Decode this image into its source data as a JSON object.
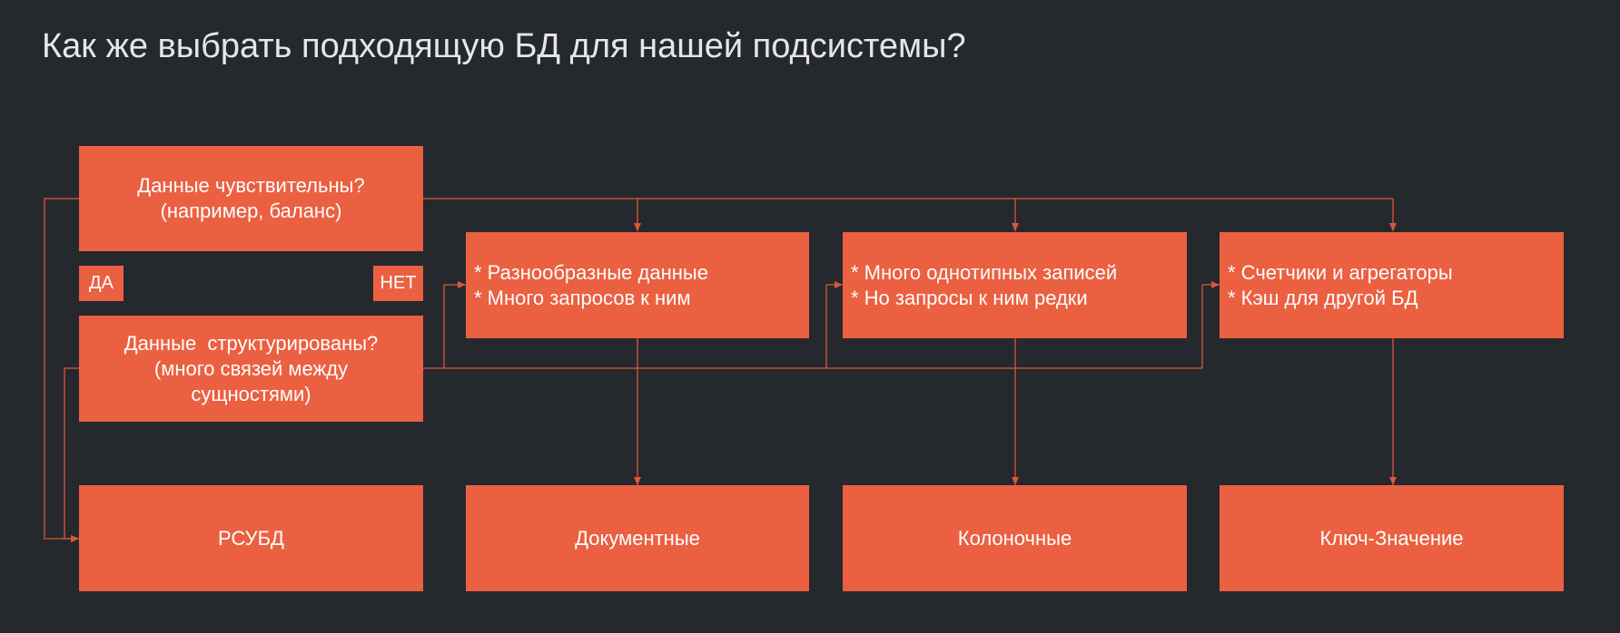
{
  "slide": {
    "title": "Как же выбрать подходящую БД для нашей подсистемы?"
  },
  "diagram": {
    "question_sensitive": {
      "line1": "Данные чувствительны?",
      "line2": "(например, баланс)"
    },
    "answer_yes": "ДА",
    "answer_no": "НЕТ",
    "question_structured": {
      "line1": "Данные  структурированы?",
      "line2": "(много связей между",
      "line3": "сущностями)"
    },
    "criteria": [
      {
        "line1": "* Разнообразные данные",
        "line2": "* Много запросов к ним"
      },
      {
        "line1": "* Много однотипных записей",
        "line2": "* Но запросы к ним редки"
      },
      {
        "line1": "* Счетчики и агрегаторы",
        "line2": "* Кэш для другой БД"
      }
    ],
    "db_types": [
      "РСУБД",
      "Документные",
      "Колоночные",
      "Ключ-Значение"
    ],
    "colors": {
      "box": "#eb6041",
      "connector": "#d9583a",
      "background": "#25282d",
      "text": "#ffffff"
    }
  }
}
